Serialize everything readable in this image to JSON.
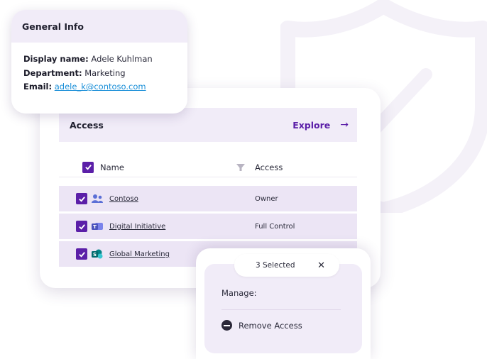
{
  "general_info": {
    "title": "General Info",
    "display_name_label": "Display name:",
    "display_name_value": "Adele Kuhlman",
    "department_label": "Department:",
    "department_value": "Marketing",
    "email_label": "Email:",
    "email_value": "adele_k@contoso.com"
  },
  "access": {
    "title": "Access",
    "explore_label": "Explore",
    "explore_arrow": "→",
    "columns": {
      "name": "Name",
      "access": "Access"
    },
    "rows": [
      {
        "name": "Contoso",
        "access": "Owner",
        "icon": "people-group-icon",
        "checked": true
      },
      {
        "name": "Digital Initiative",
        "access": "Full Control",
        "icon": "teams-icon",
        "checked": true
      },
      {
        "name": "Global Marketing",
        "access": "",
        "icon": "sharepoint-icon",
        "checked": true
      }
    ]
  },
  "selection": {
    "selected_label": "3 Selected",
    "close_glyph": "✕",
    "manage_label": "Manage:",
    "remove_label": "Remove Access"
  },
  "colors": {
    "accent": "#5b1fa8",
    "header_bg": "#f1ecf8",
    "row_bg": "#ece5f5",
    "link_blue": "#1a8fd8"
  }
}
